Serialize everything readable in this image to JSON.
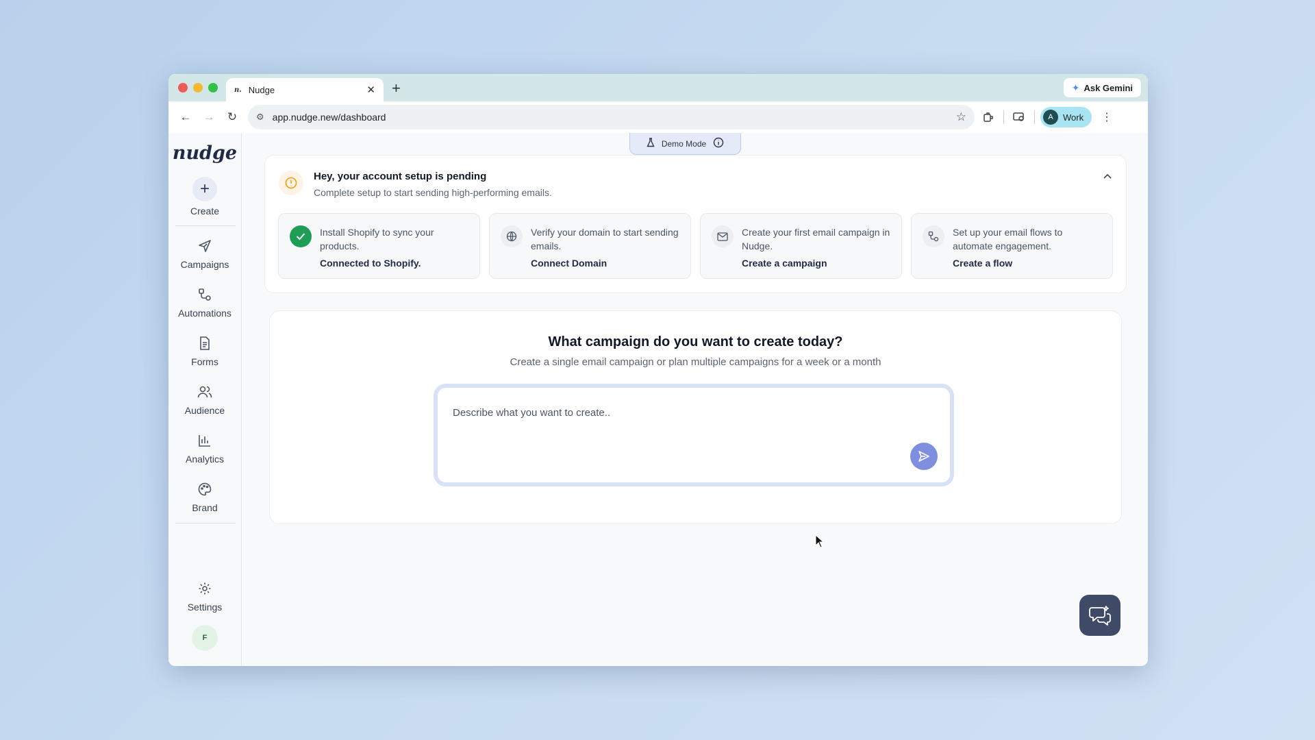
{
  "browser": {
    "tab_title": "Nudge",
    "tab_favicon": "n.",
    "gemini_label": "Ask Gemini",
    "url": "app.nudge.new/dashboard",
    "profile_initial": "A",
    "profile_label": "Work"
  },
  "app": {
    "logo": "nudge",
    "demo_mode_label": "Demo Mode"
  },
  "sidebar": {
    "create_label": "Create",
    "items": [
      {
        "label": "Campaigns",
        "icon": "send-icon"
      },
      {
        "label": "Automations",
        "icon": "flow-icon"
      },
      {
        "label": "Forms",
        "icon": "document-icon"
      },
      {
        "label": "Audience",
        "icon": "users-icon"
      },
      {
        "label": "Analytics",
        "icon": "bar-chart-icon"
      },
      {
        "label": "Brand",
        "icon": "palette-icon"
      }
    ],
    "settings_label": "Settings",
    "user_initial": "F"
  },
  "setup": {
    "title": "Hey, your account setup is pending",
    "subtitle": "Complete setup to start sending high-performing emails.",
    "steps": [
      {
        "description": "Install Shopify to sync your products.",
        "link": "Connected to Shopify.",
        "status": "done"
      },
      {
        "description": "Verify your domain to start sending emails.",
        "link": "Connect Domain",
        "status": "todo"
      },
      {
        "description": "Create your first email campaign in Nudge.",
        "link": "Create a campaign",
        "status": "todo"
      },
      {
        "description": "Set up your email flows to automate engagement.",
        "link": "Create a flow",
        "status": "todo"
      }
    ]
  },
  "create": {
    "title": "What campaign do you want to create today?",
    "subtitle": "Create a single email campaign or plan multiple campaigns for a week or a month",
    "placeholder": "Describe what you want to create.."
  },
  "colors": {
    "accent": "#7f8fe0",
    "success": "#1f9d55",
    "warning": "#f59e0b"
  }
}
